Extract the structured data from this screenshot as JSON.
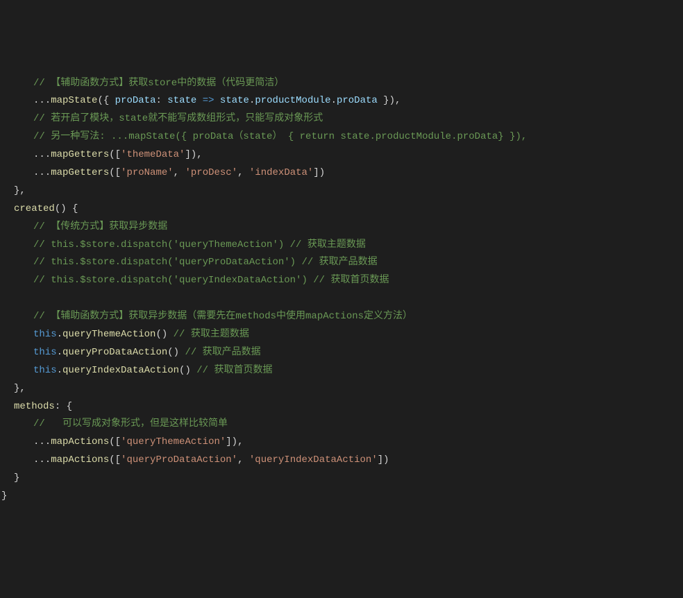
{
  "lines": [
    {
      "indent": 1,
      "tokens": [
        {
          "t": "comment",
          "v": "// 【辅助函数方式】获取store中的数据（代码更简洁）"
        }
      ]
    },
    {
      "indent": 1,
      "tokens": [
        {
          "t": "punctuation",
          "v": "..."
        },
        {
          "t": "function",
          "v": "mapState"
        },
        {
          "t": "punctuation",
          "v": "({ "
        },
        {
          "t": "variable",
          "v": "proData"
        },
        {
          "t": "punctuation",
          "v": ": "
        },
        {
          "t": "variable",
          "v": "state"
        },
        {
          "t": "punctuation",
          "v": " "
        },
        {
          "t": "keyword",
          "v": "=>"
        },
        {
          "t": "punctuation",
          "v": " "
        },
        {
          "t": "variable",
          "v": "state"
        },
        {
          "t": "punctuation",
          "v": "."
        },
        {
          "t": "variable",
          "v": "productModule"
        },
        {
          "t": "punctuation",
          "v": "."
        },
        {
          "t": "variable",
          "v": "proData"
        },
        {
          "t": "punctuation",
          "v": " }),"
        }
      ]
    },
    {
      "indent": 1,
      "tokens": [
        {
          "t": "comment",
          "v": "// 若开启了模块，state就不能写成数组形式，只能写成对象形式"
        }
      ]
    },
    {
      "indent": 1,
      "tokens": [
        {
          "t": "comment",
          "v": "// 另一种写法: ...mapState({ proData（state） { return state.productModule.proData} }),"
        }
      ]
    },
    {
      "indent": 1,
      "tokens": [
        {
          "t": "punctuation",
          "v": "..."
        },
        {
          "t": "function",
          "v": "mapGetters"
        },
        {
          "t": "punctuation",
          "v": "(["
        },
        {
          "t": "string",
          "v": "'themeData'"
        },
        {
          "t": "punctuation",
          "v": "]),"
        }
      ]
    },
    {
      "indent": 1,
      "tokens": [
        {
          "t": "punctuation",
          "v": "..."
        },
        {
          "t": "function",
          "v": "mapGetters"
        },
        {
          "t": "punctuation",
          "v": "(["
        },
        {
          "t": "string",
          "v": "'proName'"
        },
        {
          "t": "punctuation",
          "v": ", "
        },
        {
          "t": "string",
          "v": "'proDesc'"
        },
        {
          "t": "punctuation",
          "v": ", "
        },
        {
          "t": "string",
          "v": "'indexData'"
        },
        {
          "t": "punctuation",
          "v": "])"
        }
      ]
    },
    {
      "indent": 0,
      "tokens": [
        {
          "t": "punctuation",
          "v": "},"
        }
      ]
    },
    {
      "indent": 0,
      "tokens": [
        {
          "t": "function",
          "v": "created"
        },
        {
          "t": "punctuation",
          "v": "() {"
        }
      ]
    },
    {
      "indent": 1,
      "tokens": [
        {
          "t": "comment",
          "v": "// 【传统方式】获取异步数据"
        }
      ]
    },
    {
      "indent": 1,
      "tokens": [
        {
          "t": "comment",
          "v": "// this.$store.dispatch('queryThemeAction') // 获取主题数据"
        }
      ]
    },
    {
      "indent": 1,
      "tokens": [
        {
          "t": "comment",
          "v": "// this.$store.dispatch('queryProDataAction') // 获取产品数据"
        }
      ]
    },
    {
      "indent": 1,
      "tokens": [
        {
          "t": "comment",
          "v": "// this.$store.dispatch('queryIndexDataAction') // 获取首页数据"
        }
      ]
    },
    {
      "indent": 1,
      "tokens": [
        {
          "t": "punctuation",
          "v": ""
        }
      ]
    },
    {
      "indent": 1,
      "tokens": [
        {
          "t": "comment",
          "v": "// 【辅助函数方式】获取异步数据（需要先在methods中使用mapActions定义方法）"
        }
      ]
    },
    {
      "indent": 1,
      "tokens": [
        {
          "t": "this",
          "v": "this"
        },
        {
          "t": "punctuation",
          "v": "."
        },
        {
          "t": "function",
          "v": "queryThemeAction"
        },
        {
          "t": "punctuation",
          "v": "() "
        },
        {
          "t": "comment",
          "v": "// 获取主题数据"
        }
      ]
    },
    {
      "indent": 1,
      "tokens": [
        {
          "t": "this",
          "v": "this"
        },
        {
          "t": "punctuation",
          "v": "."
        },
        {
          "t": "function",
          "v": "queryProDataAction"
        },
        {
          "t": "punctuation",
          "v": "() "
        },
        {
          "t": "comment",
          "v": "// 获取产品数据"
        }
      ]
    },
    {
      "indent": 1,
      "tokens": [
        {
          "t": "this",
          "v": "this"
        },
        {
          "t": "punctuation",
          "v": "."
        },
        {
          "t": "function",
          "v": "queryIndexDataAction"
        },
        {
          "t": "punctuation",
          "v": "() "
        },
        {
          "t": "comment",
          "v": "// 获取首页数据"
        }
      ]
    },
    {
      "indent": 0,
      "tokens": [
        {
          "t": "punctuation",
          "v": "},"
        }
      ]
    },
    {
      "indent": 0,
      "tokens": [
        {
          "t": "function",
          "v": "methods"
        },
        {
          "t": "punctuation",
          "v": ": {"
        }
      ]
    },
    {
      "indent": 1,
      "tokens": [
        {
          "t": "comment",
          "v": "//   可以写成对象形式，但是这样比较简单"
        }
      ]
    },
    {
      "indent": 1,
      "tokens": [
        {
          "t": "punctuation",
          "v": "..."
        },
        {
          "t": "function",
          "v": "mapActions"
        },
        {
          "t": "punctuation",
          "v": "(["
        },
        {
          "t": "string",
          "v": "'queryThemeAction'"
        },
        {
          "t": "punctuation",
          "v": "]),"
        }
      ]
    },
    {
      "indent": 1,
      "tokens": [
        {
          "t": "punctuation",
          "v": "..."
        },
        {
          "t": "function",
          "v": "mapActions"
        },
        {
          "t": "punctuation",
          "v": "(["
        },
        {
          "t": "string",
          "v": "'queryProDataAction'"
        },
        {
          "t": "punctuation",
          "v": ", "
        },
        {
          "t": "string",
          "v": "'queryIndexDataAction'"
        },
        {
          "t": "punctuation",
          "v": "])"
        }
      ]
    },
    {
      "indent": 0,
      "tokens": [
        {
          "t": "punctuation",
          "v": "}"
        }
      ]
    },
    {
      "indent": -1,
      "tokens": [
        {
          "t": "punctuation",
          "v": "}"
        }
      ]
    }
  ]
}
